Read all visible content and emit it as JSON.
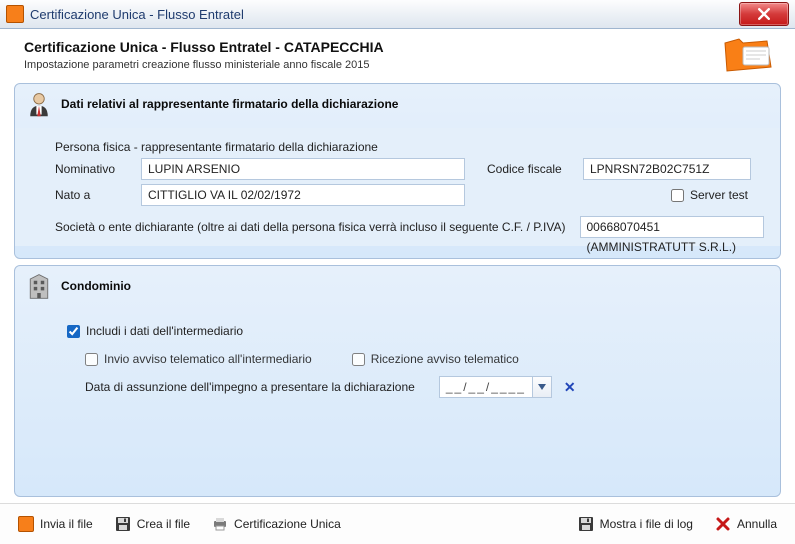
{
  "window": {
    "title": "Certificazione Unica - Flusso Entratel"
  },
  "header": {
    "title": "Certificazione Unica - Flusso Entratel - CATAPECCHIA",
    "subtitle": "Impostazione parametri creazione flusso ministeriale anno fiscale 2015"
  },
  "group_firm": {
    "title": "Dati relativi al rappresentante firmatario della dichiarazione",
    "persona_label": "Persona fisica - rappresentante firmatario della dichiarazione",
    "nominativo_label": "Nominativo",
    "nominativo_value": "LUPIN ARSENIO",
    "cf_label": "Codice fiscale",
    "cf_value": "LPNRSN72B02C751Z",
    "natoa_label": "Nato a",
    "natoa_value": "CITTIGLIO VA IL 02/02/1972",
    "server_test_label": "Server test",
    "societa_label": "Società o ente dichiarante (oltre ai dati della persona fisica verrà incluso il seguente C.F. / P.IVA)",
    "societa_value": "00668070451 (AMMINISTRATUTT S.R.L.)"
  },
  "group_condo": {
    "title": "Condominio",
    "includi_label": "Includi i dati dell'intermediario",
    "invio_label": "Invio avviso telematico all'intermediario",
    "ricezione_label": "Ricezione avviso telematico",
    "data_label": "Data di assunzione dell'impegno a presentare la dichiarazione",
    "data_value": "__/__/____"
  },
  "footer": {
    "invia": "Invia il file",
    "crea": "Crea il file",
    "cert": "Certificazione Unica",
    "log": "Mostra i file di log",
    "annulla": "Annulla"
  }
}
